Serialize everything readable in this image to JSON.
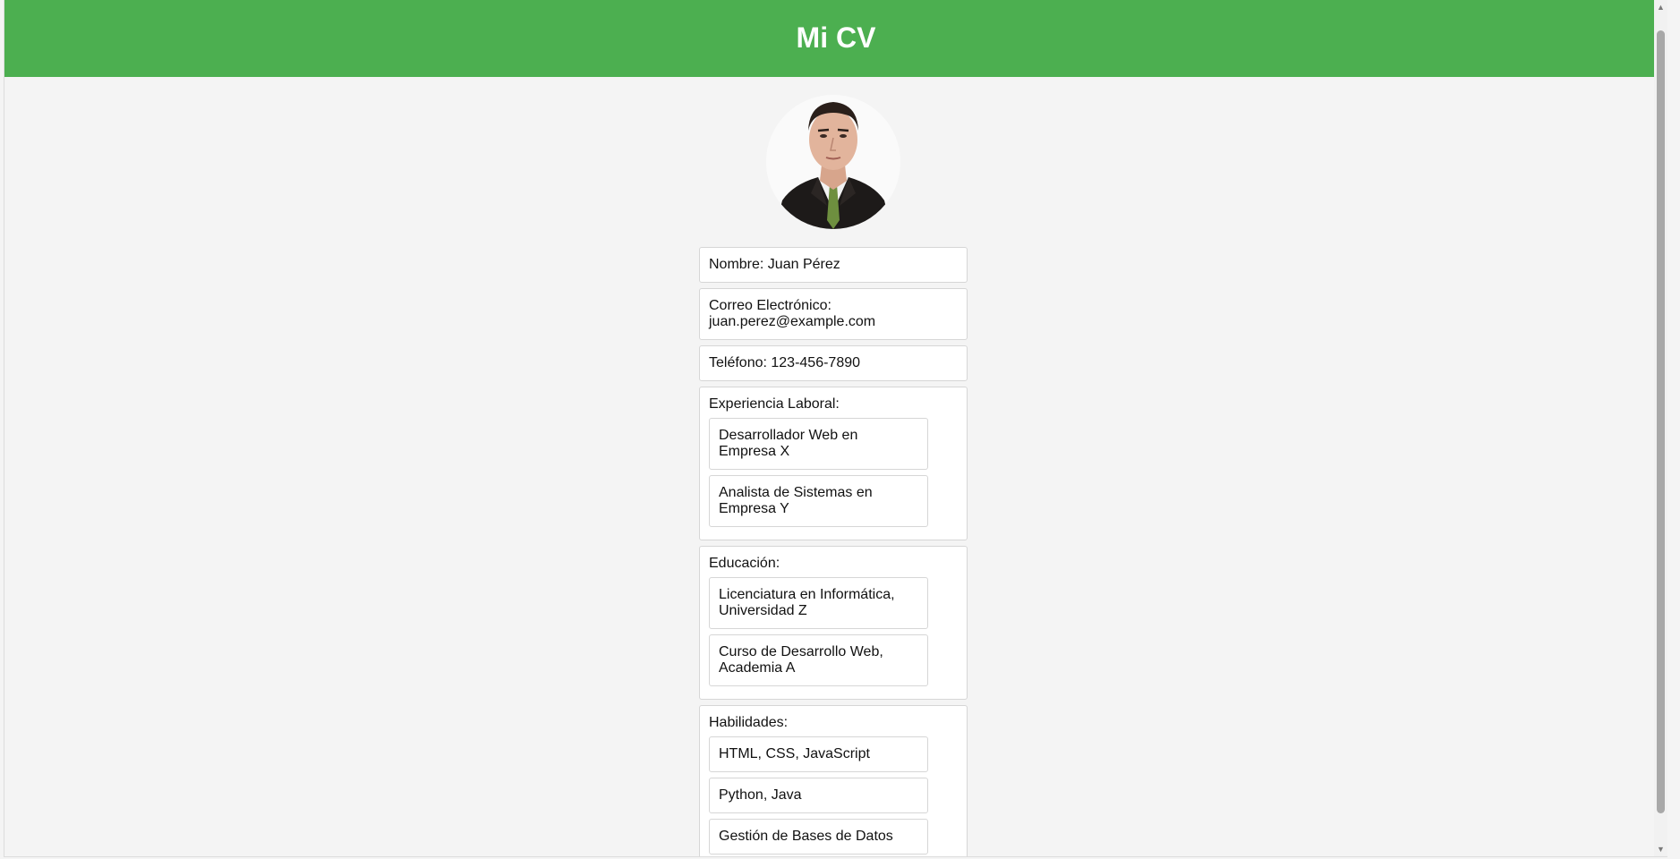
{
  "header": {
    "title": "Mi CV",
    "color": "#4caf50"
  },
  "profile": {
    "photo_icon": "person-portrait"
  },
  "fields": {
    "name": "Nombre: Juan Pérez",
    "email_label": "Correo Electrónico:",
    "email_value": "juan.perez@example.com",
    "phone": "Teléfono: 123-456-7890"
  },
  "experience": {
    "title": "Experiencia Laboral:",
    "items": [
      "Desarrollador Web en Empresa X",
      "Analista de Sistemas en Empresa Y"
    ]
  },
  "education": {
    "title": "Educación:",
    "items": [
      "Licenciatura en Informática, Universidad Z",
      "Curso de Desarrollo Web, Academia A"
    ]
  },
  "skills": {
    "title": "Habilidades:",
    "items": [
      "HTML, CSS, JavaScript",
      "Python, Java",
      "Gestión de Bases de Datos"
    ]
  }
}
